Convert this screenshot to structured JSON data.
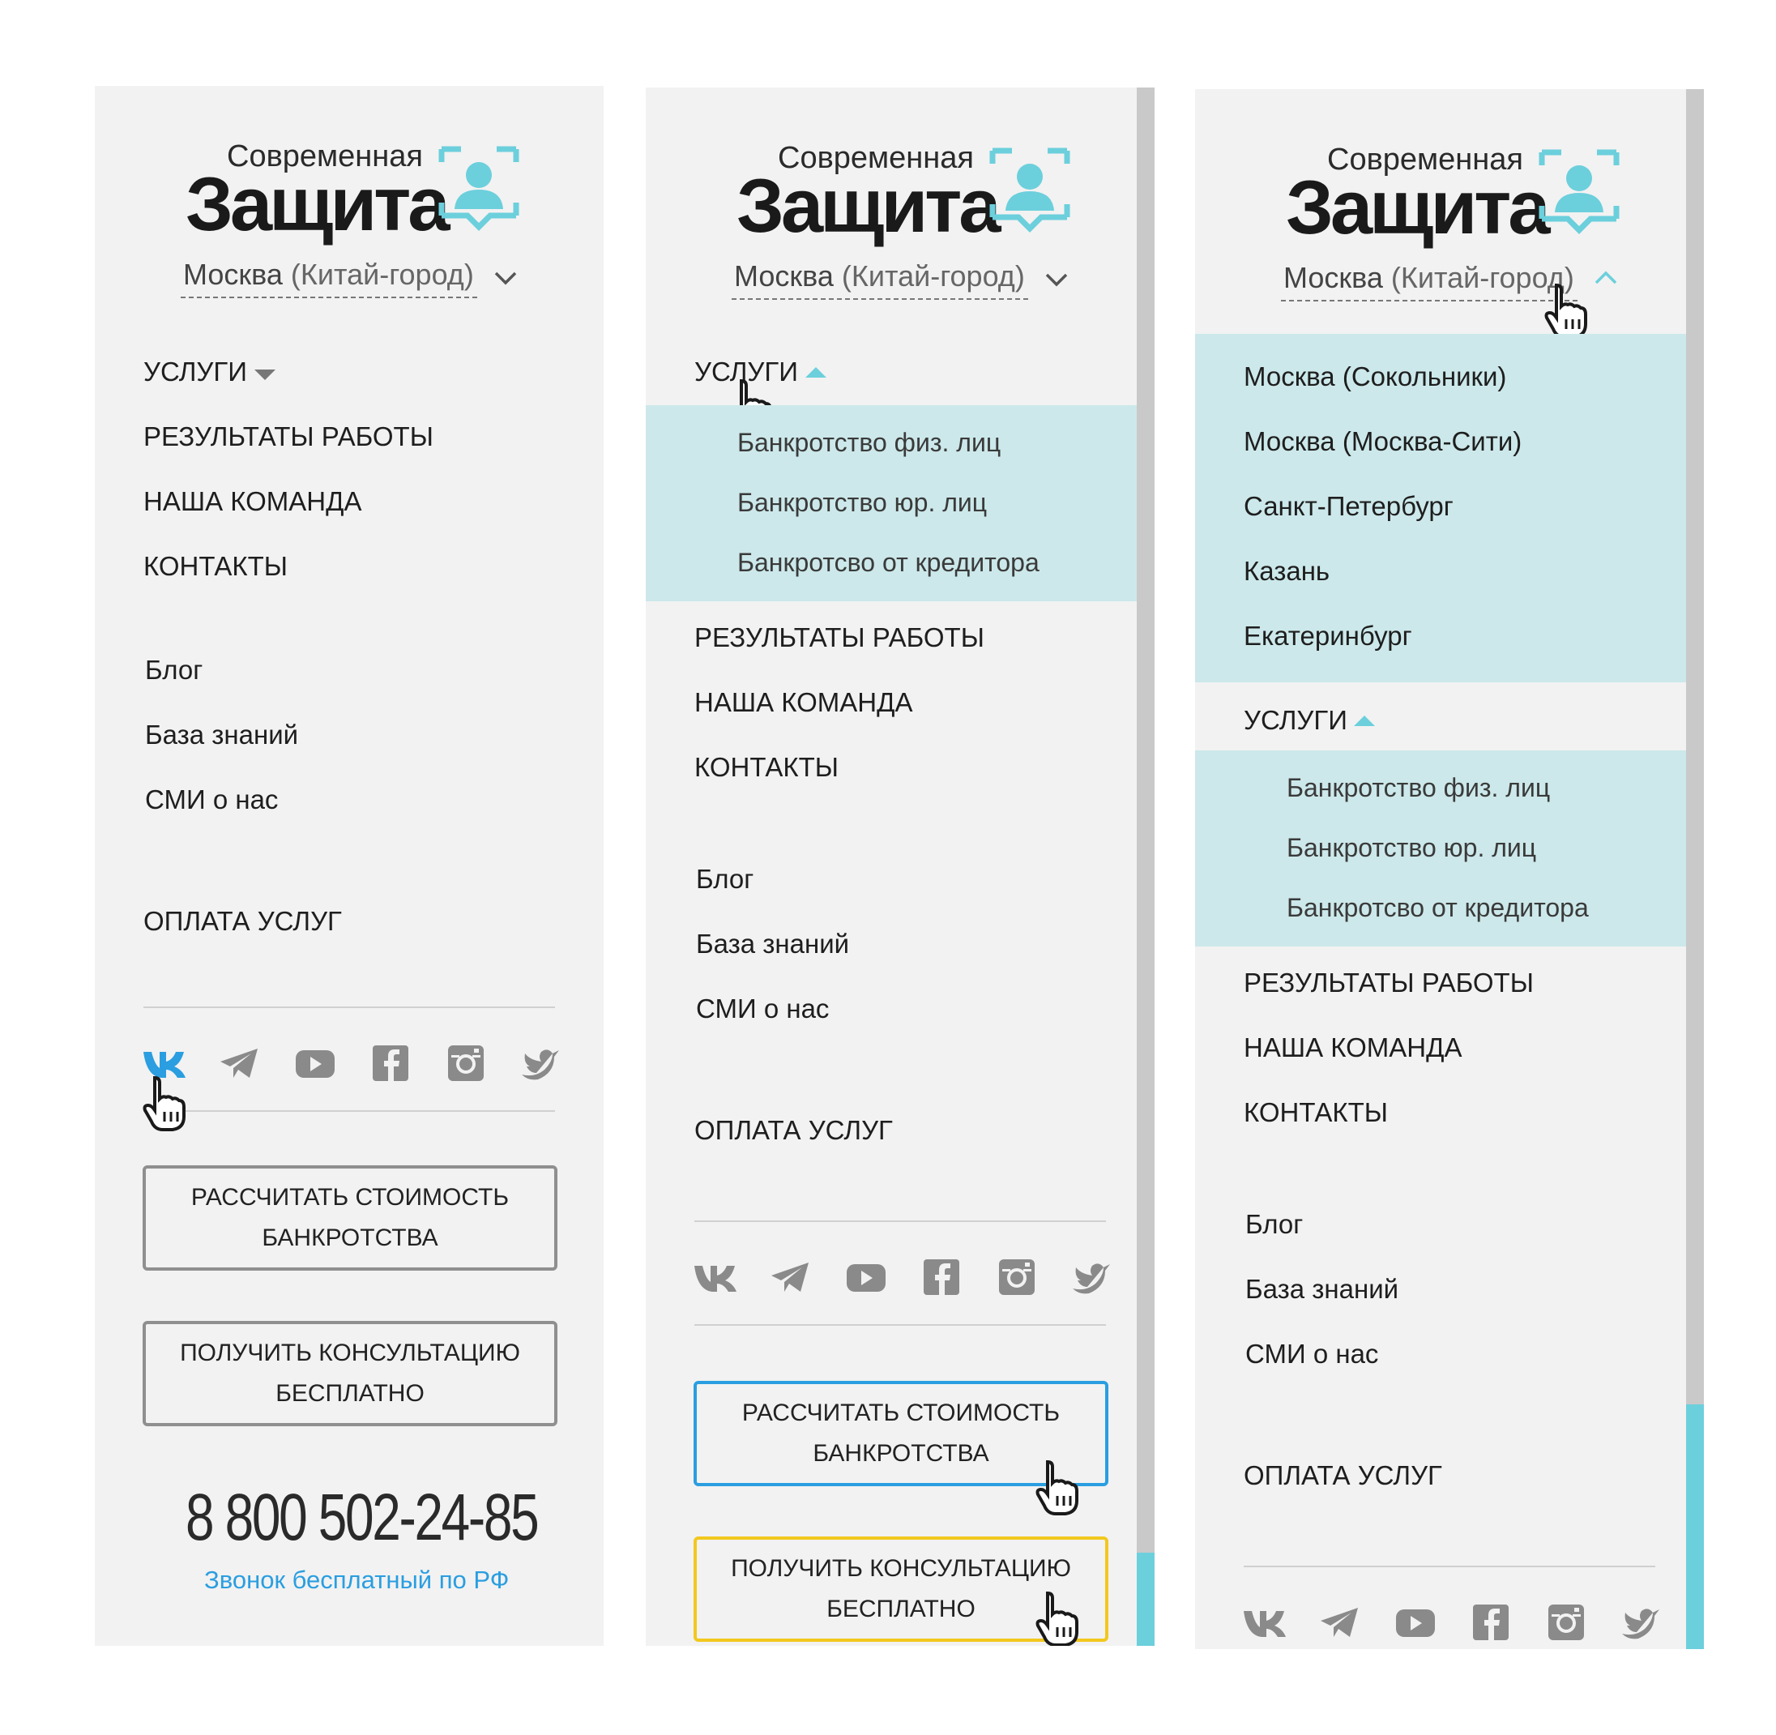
{
  "brand": {
    "logo_small": "Современная",
    "logo_big": "Защита"
  },
  "city": {
    "main": "Москва",
    "sub": "(Китай-город)",
    "options": [
      "Москва (Сокольники)",
      "Москва (Москва-Сити)",
      "Санкт-Петербург",
      "Казань",
      "Екатеринбург"
    ]
  },
  "nav": {
    "services": "УСЛУГИ",
    "results": "РЕЗУЛЬТАТЫ РАБОТЫ",
    "team": "НАША КОМАНДА",
    "contacts": "КОНТАКТЫ",
    "services_sub": [
      "Банкротство физ. лиц",
      "Банкротство юр. лиц",
      "Банкротсво от кредитора"
    ]
  },
  "secondary": {
    "blog": "Блог",
    "knowledge": "База знаний",
    "media": "СМИ о нас"
  },
  "payment": "ОПЛАТА УСЛУГ",
  "social": [
    "vk-icon",
    "telegram-icon",
    "youtube-icon",
    "facebook-icon",
    "instagram-icon",
    "twitter-icon"
  ],
  "buttons": {
    "calc": [
      "РАССЧИТАТЬ СТОИМОСТЬ",
      "БАНКРОТСТВА"
    ],
    "consult": [
      "ПОЛУЧИТЬ КОНСУЛЬТАЦИЮ",
      "БЕСПЛАТНО"
    ]
  },
  "phone": {
    "number": "8 800 502-24-85",
    "note": "Звонок бесплатный по РФ"
  },
  "colors": {
    "accent": "#6ccfdc",
    "highlight_bg": "#cce8ea",
    "panel_bg": "#f2f2f2",
    "link_blue": "#2a9ee0",
    "btn_hover_blue": "#2a9ee0",
    "btn_hover_yellow": "#f2c81e",
    "vk_active": "#2a9ee0",
    "icon_gray": "#8a8a8a"
  }
}
